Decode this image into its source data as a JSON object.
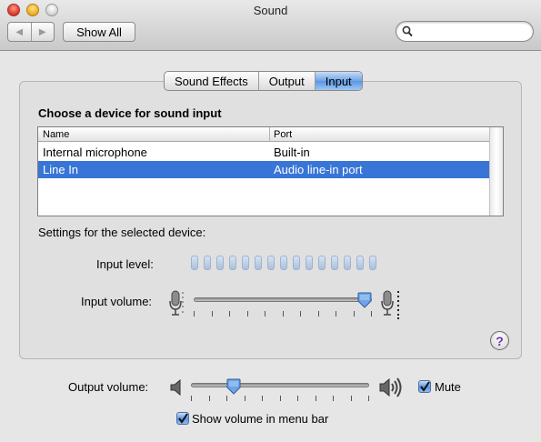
{
  "window": {
    "title": "Sound"
  },
  "toolbar": {
    "show_all_label": "Show All",
    "search_value": "",
    "search_placeholder": ""
  },
  "tabs": [
    {
      "label": "Sound Effects",
      "selected": false
    },
    {
      "label": "Output",
      "selected": false
    },
    {
      "label": "Input",
      "selected": true
    }
  ],
  "input_panel": {
    "section_title": "Choose a device for sound input",
    "columns": [
      "Name",
      "Port"
    ],
    "devices": [
      {
        "name": "Internal microphone",
        "port": "Built-in",
        "selected": false
      },
      {
        "name": "Line In",
        "port": "Audio line-in port",
        "selected": true
      }
    ],
    "settings_label": "Settings for the selected device:",
    "input_level_label": "Input level:",
    "input_level_segments": 15,
    "input_level_lit": 0,
    "input_volume_label": "Input volume:",
    "input_volume_fraction": 0.96
  },
  "output": {
    "volume_label": "Output volume:",
    "volume_fraction": 0.24,
    "mute_label": "Mute",
    "mute_checked": true,
    "show_in_menu_label": "Show volume in menu bar",
    "show_in_menu_checked": true
  },
  "help": {
    "glyph": "?"
  },
  "icons": [
    "back-arrow-icon",
    "forward-arrow-icon",
    "search-icon",
    "microphone-icon",
    "speaker-icon",
    "help-icon",
    "checkmark-icon"
  ],
  "colors": {
    "selection": "#3875d7",
    "active_tab": "#6fa4e6",
    "level_segment": "#b7cbe4"
  }
}
